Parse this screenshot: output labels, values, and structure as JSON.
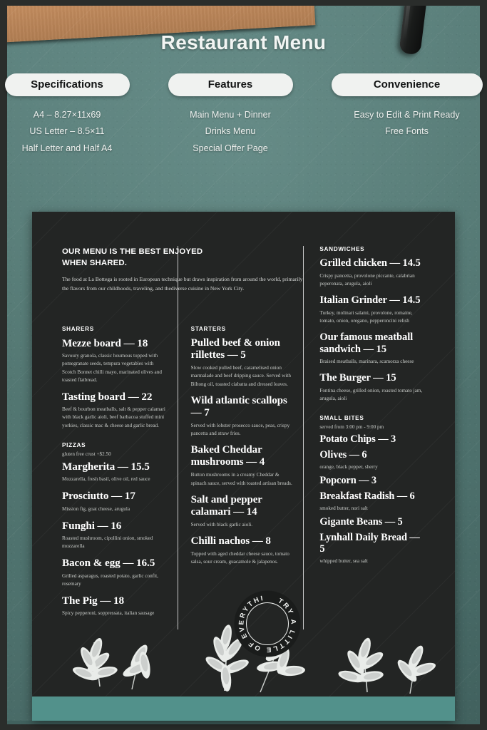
{
  "promo": {
    "title": "Restaurant Menu",
    "columns": [
      {
        "pill_label": "Specifications",
        "lines": [
          "A4 – 8.27×11x69",
          "US Letter – 8.5×11",
          "Half Letter and Half A4"
        ]
      },
      {
        "pill_label": "Features",
        "lines": [
          "Main Menu + Dinner",
          "Drinks Menu",
          "Special Offer Page"
        ]
      },
      {
        "pill_label": "Convenience",
        "lines": [
          "Easy to Edit & Print Ready",
          "Free Fonts"
        ]
      }
    ]
  },
  "menu": {
    "intro": {
      "title_line1": "OUR MENU IS THE BEST ENJOYED",
      "title_line2": "WHEN SHARED.",
      "body": "The food at La Bottega is rooted in European technique but draws inspiration from around the world, primarily the flavors from our childhoods, traveling, and thediverse cuisine in New York City."
    },
    "stamp_text": "TRY A LITTLE OF EVERYTHING!",
    "sections": {
      "sharers": {
        "label": "SHARERS",
        "items": [
          {
            "name": "Mezze board — 18",
            "desc": "Savoury granola, classic houmous topped with pomegranate seeds, tempura vegetables with Scotch Bonnet chilli mayo, marinated olives and toasted flatbread."
          },
          {
            "name": "Tasting board — 22",
            "desc": "Beef & bourbon meatballs, salt & pepper calamari with black garlic aioli, beef barbacoa stuffed mini yorkies, classic mac & cheese and garlic bread."
          }
        ]
      },
      "pizzas": {
        "label": "PIZZAS",
        "note": "gluten free crust +$2.50",
        "items": [
          {
            "name": "Margherita — 15.5",
            "desc": "Mozzarella, fresh basil, olive oil, red sauce"
          },
          {
            "name": "Prosciutto — 17",
            "desc": "Mission fig, goat cheese, arugula"
          },
          {
            "name": "Funghi — 16",
            "desc": "Roasted mushroom, cipollini onion, smoked mozzarella"
          },
          {
            "name": "Bacon & egg — 16.5",
            "desc": "Grilled asparagus, roasted potato, garlic confit, rosemary"
          },
          {
            "name": "The Pig — 18",
            "desc": "Spicy pepperoni, soppressata, italian sausage"
          }
        ]
      },
      "starters": {
        "label": "STARTERS",
        "items": [
          {
            "name": "Pulled beef & onion rillettes — 5",
            "desc": "Slow cooked pulled beef, caramelised onion marmalade and beef dripping sauce. Served with Biltong oil, toasted ciabatta and dressed leaves."
          },
          {
            "name": "Wild atlantic scallops — 7",
            "desc": "Served with lobster prosecco sauce, peas, crispy pancetta and straw fries."
          },
          {
            "name": "Baked Cheddar mushrooms — 4",
            "desc": "Button mushrooms in a creamy Cheddar & spinach sauce, served with toasted artisan breads."
          },
          {
            "name": "Salt and pepper calamari — 14",
            "desc": "Served with black garlic aioli."
          },
          {
            "name": "Chilli nachos — 8",
            "desc": "Topped with aged cheddar cheese sauce, tomato salsa, sour cream, guacamole & jalapenos."
          }
        ]
      },
      "sandwiches": {
        "label": "SANDWICHES",
        "items": [
          {
            "name": "Grilled chicken — 14.5",
            "desc": "Crispy pancetta, provolone piccante, calabrian peperonata, arugula, aioli"
          },
          {
            "name": "Italian Grinder — 14.5",
            "desc": "Turkey, molinari salami, provolone, romaine, tomato, onion, oregano, pepperoncini relish"
          },
          {
            "name": "Our famous meatball sandwich — 15",
            "desc": "Braised meatballs, marinara, scamorza cheese"
          },
          {
            "name": "The Burger — 15",
            "desc": "Fontina cheese, grilled onion, roasted tomato jam, arugula, aioli"
          }
        ]
      },
      "small_bites": {
        "label": "SMALL BITES",
        "note": "served from 3:00 pm - 9:00 pm",
        "items": [
          {
            "name": "Potato Chips — 3",
            "desc": ""
          },
          {
            "name": "Olives — 6",
            "desc": "orange, black pepper, sherry"
          },
          {
            "name": "Popcorn — 3",
            "desc": ""
          },
          {
            "name": "Breakfast Radish — 6",
            "desc": "smoked butter, nori salt"
          },
          {
            "name": "Gigante Beans — 5",
            "desc": ""
          },
          {
            "name": "Lynhall Daily Bread — 5",
            "desc": "whipped butter, sea salt"
          }
        ]
      }
    }
  },
  "colors": {
    "backdrop_teal": "#4d706c",
    "card_dark": "#232524",
    "accent_teal_bar": "#52918b",
    "pill_bg": "#f0f2f0",
    "wood": "#c08a5c"
  }
}
